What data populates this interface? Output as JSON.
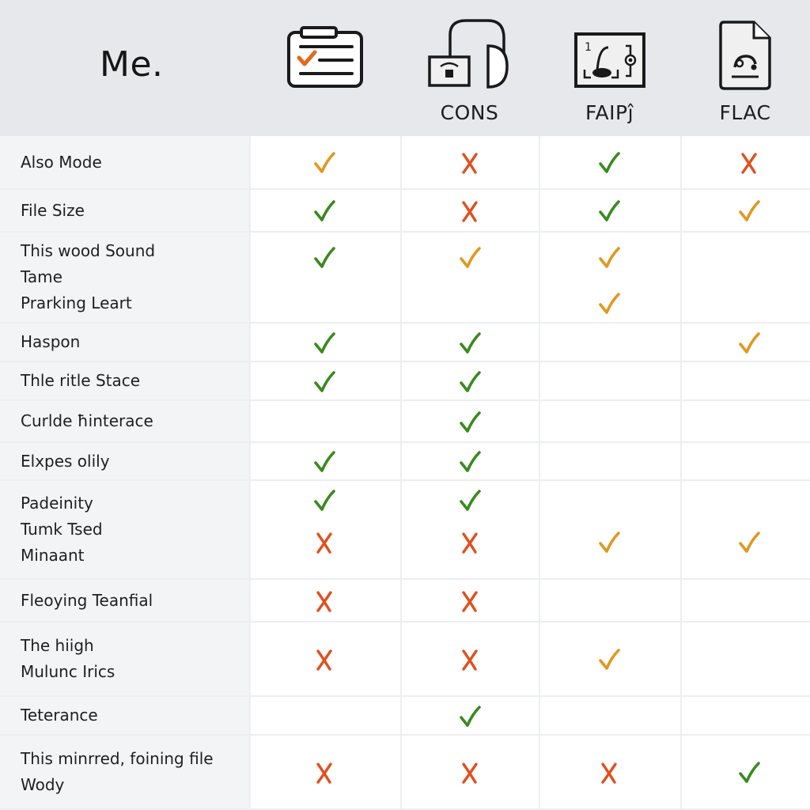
{
  "header": {
    "brand": "Me.",
    "columns": [
      {
        "icon": "checklist-clipboard-icon",
        "label": ""
      },
      {
        "icon": "headphones-device-icon",
        "label": "CONS"
      },
      {
        "icon": "microphone-frame-icon",
        "label": "FAIPĵ"
      },
      {
        "icon": "audio-file-icon",
        "label": "FLAC"
      }
    ]
  },
  "colors": {
    "check_green": "#3a8a1e",
    "check_orange": "#e0981e",
    "cross_red": "#e0501e",
    "header_bg": "#e6e8ec",
    "label_bg": "#f3f4f6"
  },
  "rows": [
    {
      "lines": [
        "Also Mode"
      ],
      "marks": [
        [
          "check-orange"
        ],
        [
          "cross"
        ],
        [
          "check-green"
        ],
        [
          "cross"
        ]
      ]
    },
    {
      "lines": [
        "File Size"
      ],
      "marks": [
        [
          "check-green"
        ],
        [
          "cross"
        ],
        [
          "check-green"
        ],
        [
          "check-orange"
        ]
      ]
    },
    {
      "lines": [
        "This wood Sound",
        "Tame",
        "Prarking Leart"
      ],
      "marks": [
        [
          "check-green"
        ],
        [
          "check-orange"
        ],
        [
          "check-orange",
          "check-orange"
        ],
        []
      ]
    },
    {
      "lines": [
        "Haspon"
      ],
      "marks": [
        [
          "check-green"
        ],
        [
          "check-green"
        ],
        [],
        [
          "check-orange"
        ]
      ]
    },
    {
      "lines": [
        "Thle ritle Stace"
      ],
      "marks": [
        [
          "check-green"
        ],
        [
          "check-green"
        ],
        [],
        []
      ]
    },
    {
      "lines": [
        "Curlde ħinterace"
      ],
      "marks": [
        [],
        [
          "check-green"
        ],
        [],
        []
      ]
    },
    {
      "lines": [
        "Elxpes olily"
      ],
      "marks": [
        [
          "check-green"
        ],
        [
          "check-green"
        ],
        [],
        []
      ]
    },
    {
      "lines": [
        "Padeinity",
        "Tumk Tsed",
        "Minaant"
      ],
      "marks": [
        [
          "check-green",
          "cross"
        ],
        [
          "check-green",
          "cross"
        ],
        [
          "check-orange"
        ],
        [
          "check-orange"
        ]
      ]
    },
    {
      "lines": [
        "Fleoying Teanfial"
      ],
      "marks": [
        [
          "cross"
        ],
        [
          "cross"
        ],
        [],
        []
      ]
    },
    {
      "lines": [
        "The hiigh",
        "Mulunc Irics"
      ],
      "marks": [
        [
          "cross"
        ],
        [
          "cross"
        ],
        [
          "check-orange"
        ],
        []
      ]
    },
    {
      "lines": [
        "Teterance"
      ],
      "marks": [
        [],
        [
          "check-green"
        ],
        [],
        []
      ]
    },
    {
      "lines": [
        "This minrred, foining file",
        "Wody"
      ],
      "marks": [
        [
          "cross"
        ],
        [
          "cross"
        ],
        [
          "cross"
        ],
        [
          "check-green"
        ]
      ]
    }
  ]
}
